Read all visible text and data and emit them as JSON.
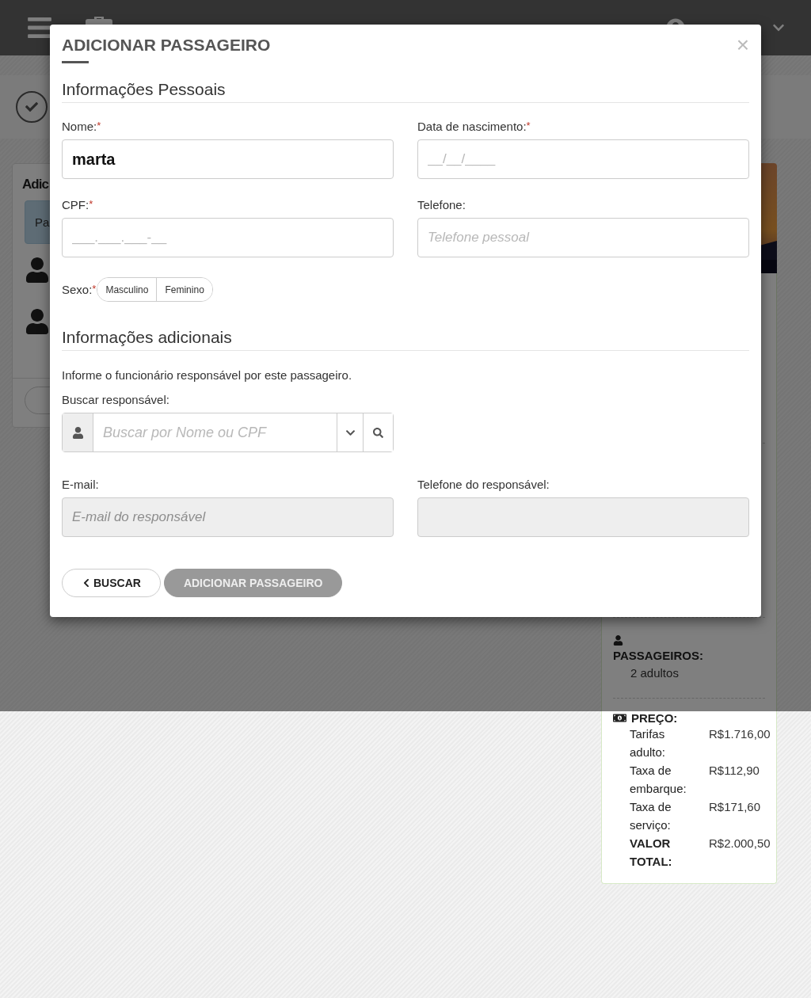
{
  "background": {
    "card_title": "Adic",
    "tab_label": "Pa"
  },
  "summary": {
    "passengers": {
      "label": "PASSAGEIROS:",
      "value": "2 adultos"
    },
    "price": {
      "label": "PREÇO:",
      "rows": [
        {
          "label": "Tarifas adulto:",
          "value": "R$1.716,00",
          "kind": "item"
        },
        {
          "label": "Taxa de embarque:",
          "value": "R$112,90",
          "kind": "item"
        },
        {
          "label": "Taxa de serviço:",
          "value": "R$171,60",
          "kind": "item"
        },
        {
          "label": "VALOR TOTAL:",
          "value": "R$2.000,50",
          "kind": "total"
        }
      ]
    }
  },
  "modal": {
    "title": "ADICIONAR PASSAGEIRO",
    "close": "×",
    "personal": {
      "heading": "Informações Pessoais",
      "fields": [
        {
          "label": "Nome:",
          "required_mark": "*",
          "value": "marta",
          "disabled": false
        },
        {
          "label": "Data de nascimento:",
          "required_mark": "*",
          "placeholder": "__/__/____",
          "disabled": false
        },
        {
          "label": "CPF:",
          "required_mark": "*",
          "placeholder": "___.___.___-__",
          "disabled": false
        },
        {
          "label": "Telefone:",
          "placeholder": "Telefone pessoal",
          "disabled": false
        }
      ],
      "sex": {
        "label": "Sexo:",
        "required_mark": "*",
        "options": [
          {
            "label": "Masculino",
            "selected": false
          },
          {
            "label": "Feminino",
            "selected": false
          }
        ]
      }
    },
    "additional": {
      "heading": "Informações adicionais",
      "note": "Informe o funcionário responsável por este passageiro.",
      "search": {
        "label": "Buscar responsável:",
        "placeholder": "Buscar por Nome ou CPF"
      },
      "fields": [
        {
          "label": "E-mail:",
          "placeholder": "E-mail do responsável",
          "disabled": true
        },
        {
          "label": "Telefone do responsável:",
          "disabled": true
        }
      ]
    },
    "buttons": [
      {
        "label": "BUSCAR",
        "kind": "back",
        "disabled": false
      },
      {
        "label": "ADICIONAR PASSAGEIRO",
        "kind": "primary",
        "disabled": true
      }
    ]
  }
}
